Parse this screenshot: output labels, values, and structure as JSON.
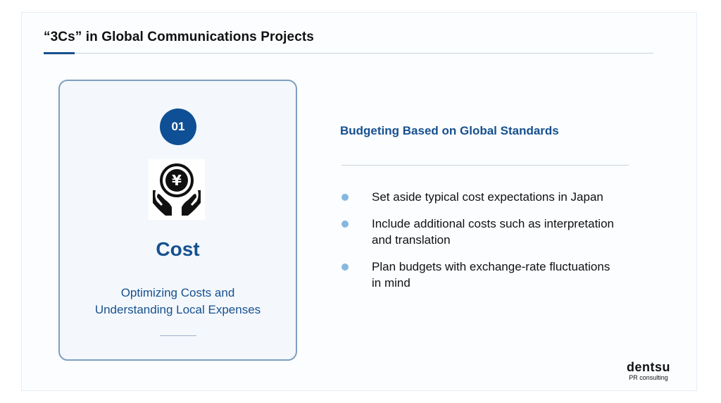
{
  "slide": {
    "title": "“3Cs” in Global Communications  Projects"
  },
  "card": {
    "number": "01",
    "icon": "yen-coin-hands-icon",
    "heading": "Cost",
    "subtitle_line1": "Optimizing Costs and",
    "subtitle_line2": "Understanding Local Expenses"
  },
  "content": {
    "heading": "Budgeting Based on Global Standards",
    "bullets": [
      {
        "line1": "Set aside typical cost expectations in Japan",
        "line2": ""
      },
      {
        "line1": "Include additional costs such as interpretation",
        "line2": "and translation"
      },
      {
        "line1": "Plan budgets with exchange-rate fluctuations",
        "line2": "in mind"
      }
    ]
  },
  "logo": {
    "main": "dentsu",
    "sub": "PR consulting"
  },
  "colors": {
    "accent": "#16508f",
    "bullet": "#86b7df"
  }
}
